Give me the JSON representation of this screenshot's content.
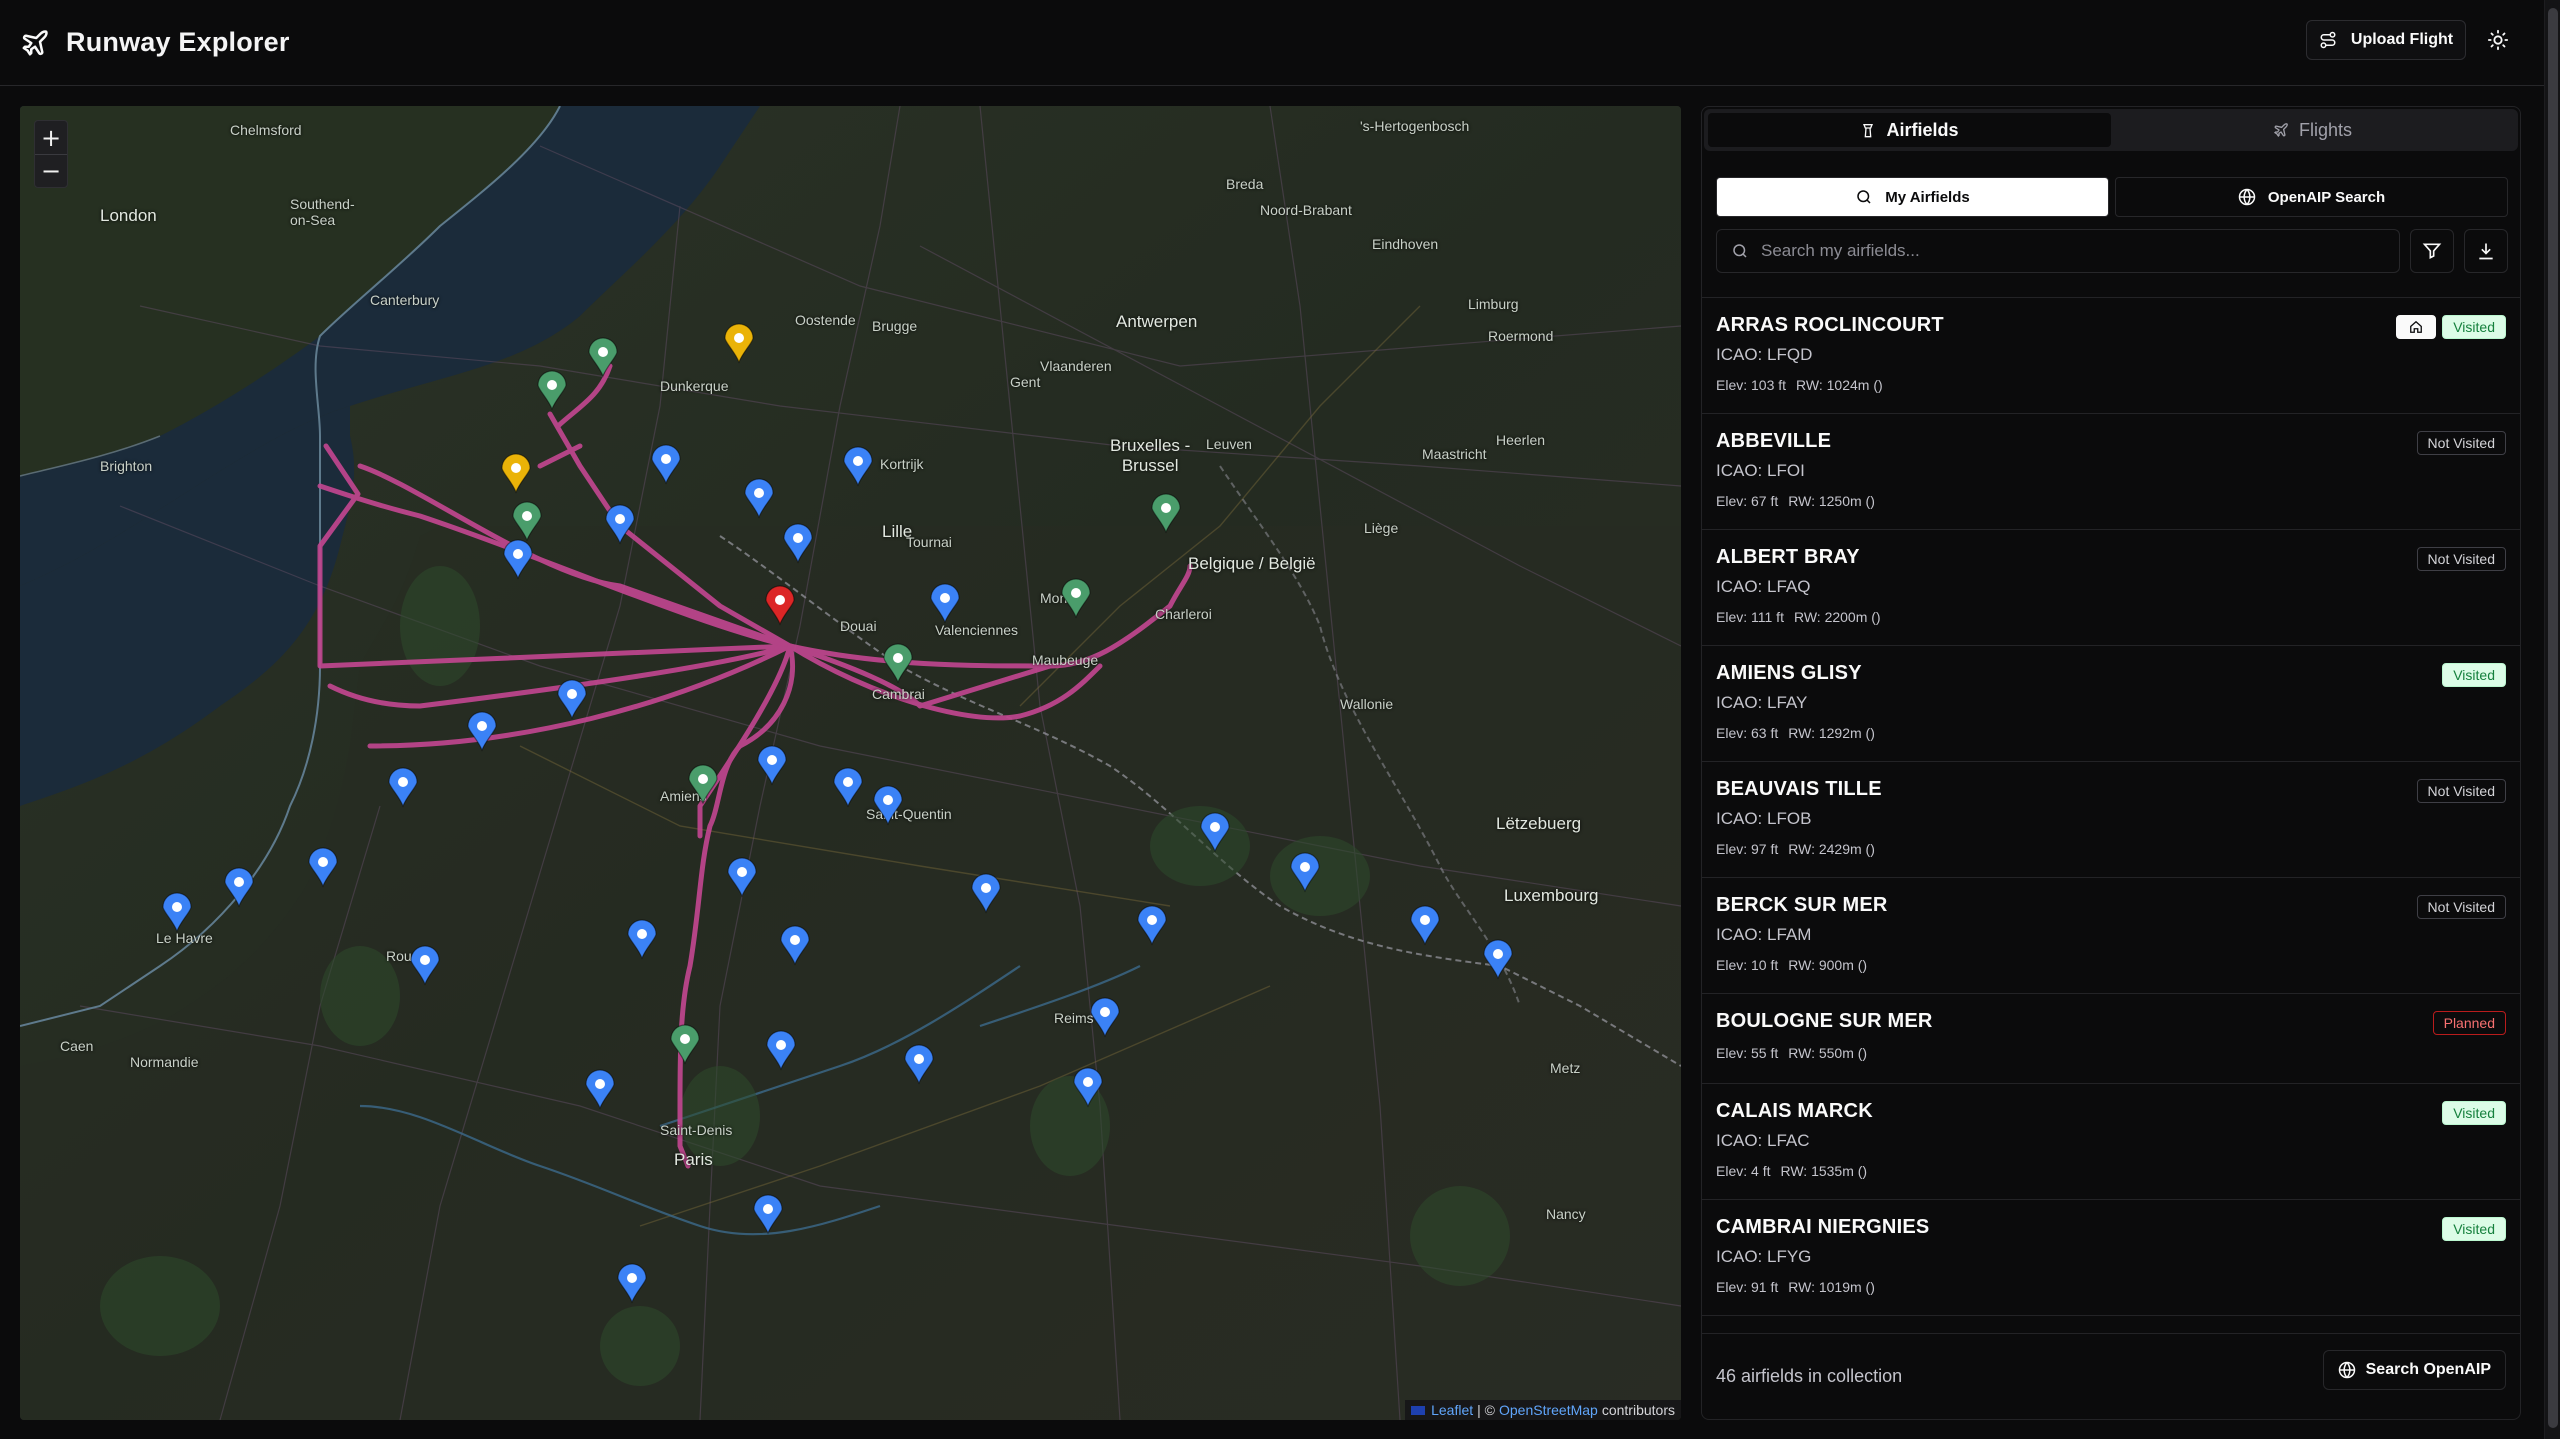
{
  "app": {
    "title": "Runway Explorer"
  },
  "header": {
    "upload_label": "Upload Flight"
  },
  "map": {
    "zoom_in": "+",
    "zoom_out": "−",
    "attribution": {
      "leaflet": "Leaflet",
      "sep": "| ©",
      "osm": "OpenStreetMap",
      "contributors": "contributors"
    },
    "labels": {
      "london": "London",
      "canterbury": "Canterbury",
      "brighton": "Brighton",
      "chelmsford": "Chelmsford",
      "dunkerque": "Dunkerque",
      "oostende": "Oostende",
      "brugge": "Brugge",
      "antwerpen": "Antwerpen",
      "bruxelles": "Bruxelles -\nBrussel",
      "lille": "Lille",
      "kortrijk": "Kortrijk",
      "tournai": "Tournai",
      "douai": "Douai",
      "valenciennes": "Valenciennes",
      "mons": "Mons",
      "charleroi": "Charleroi",
      "maubeuge": "Maubeuge",
      "cambrai": "Cambrai",
      "amiens": "Amiens",
      "saint_quentin": "Saint-Quentin",
      "le_havre": "Le Havre",
      "rouen": "Rouen",
      "caen": "Caen",
      "normandie": "Normandie",
      "paris": "Paris",
      "saint_denis": "Saint-Denis",
      "reims": "Reims",
      "metz": "Metz",
      "nancy": "Nancy",
      "luxembourg": "Luxembourg",
      "letzebuerg": "Lëtzebuerg",
      "belgique": "Belgique / België",
      "liege": "Liège",
      "maastricht": "Maastricht",
      "eindhoven": "Eindhoven",
      "breda": "Breda",
      "noord_brabant": "Noord-Brabant",
      "vlaanderen": "Vlaanderen",
      "wallonie": "Wallonie",
      "leuven": "Leuven",
      "gent": "Gent",
      "southend": "Southend-\non-Sea",
      "hertogenbosch": "'s-Hertogenbosch",
      "heerlen": "Heerlen",
      "roermond": "Roermond",
      "limburg": "Limburg",
      "bruxelles2": "Brussel"
    }
  },
  "panel": {
    "tabs": [
      {
        "label": "Airfields",
        "active": true
      },
      {
        "label": "Flights",
        "active": false
      }
    ],
    "subtabs": [
      {
        "label": "My Airfields",
        "active": true
      },
      {
        "label": "OpenAIP Search",
        "active": false
      }
    ],
    "search_placeholder": "Search my airfields...",
    "airfields": [
      {
        "name": "ARRAS ROCLINCOURT",
        "icao": "ICAO: LFQD",
        "elev": "Elev: 103 ft",
        "rw": "RW: 1024m ()",
        "status": "Visited",
        "home": true
      },
      {
        "name": "ABBEVILLE",
        "icao": "ICAO: LFOI",
        "elev": "Elev: 67 ft",
        "rw": "RW: 1250m ()",
        "status": "Not Visited",
        "home": false
      },
      {
        "name": "ALBERT BRAY",
        "icao": "ICAO: LFAQ",
        "elev": "Elev: 111 ft",
        "rw": "RW: 2200m ()",
        "status": "Not Visited",
        "home": false
      },
      {
        "name": "AMIENS GLISY",
        "icao": "ICAO: LFAY",
        "elev": "Elev: 63 ft",
        "rw": "RW: 1292m ()",
        "status": "Visited",
        "home": false
      },
      {
        "name": "BEAUVAIS TILLE",
        "icao": "ICAO: LFOB",
        "elev": "Elev: 97 ft",
        "rw": "RW: 2429m ()",
        "status": "Not Visited",
        "home": false
      },
      {
        "name": "BERCK SUR MER",
        "icao": "ICAO: LFAM",
        "elev": "Elev: 10 ft",
        "rw": "RW: 900m ()",
        "status": "Not Visited",
        "home": false
      },
      {
        "name": "BOULOGNE SUR MER",
        "icao": "",
        "elev": "Elev: 55 ft",
        "rw": "RW: 550m ()",
        "status": "Planned",
        "home": false
      },
      {
        "name": "CALAIS MARCK",
        "icao": "ICAO: LFAC",
        "elev": "Elev: 4 ft",
        "rw": "RW: 1535m ()",
        "status": "Visited",
        "home": false
      },
      {
        "name": "CAMBRAI NIERGNIES",
        "icao": "ICAO: LFYG",
        "elev": "Elev: 91 ft",
        "rw": "RW: 1019m ()",
        "status": "Visited",
        "home": false
      }
    ],
    "footer": {
      "count": "46 airfields in collection",
      "search_label": "Search OpenAIP"
    }
  },
  "colors": {
    "visited": "#4a9d6b",
    "not_visited": "#3b82f6",
    "planned": "#eab308",
    "home": "#dc2626",
    "route": "#c0468f"
  }
}
